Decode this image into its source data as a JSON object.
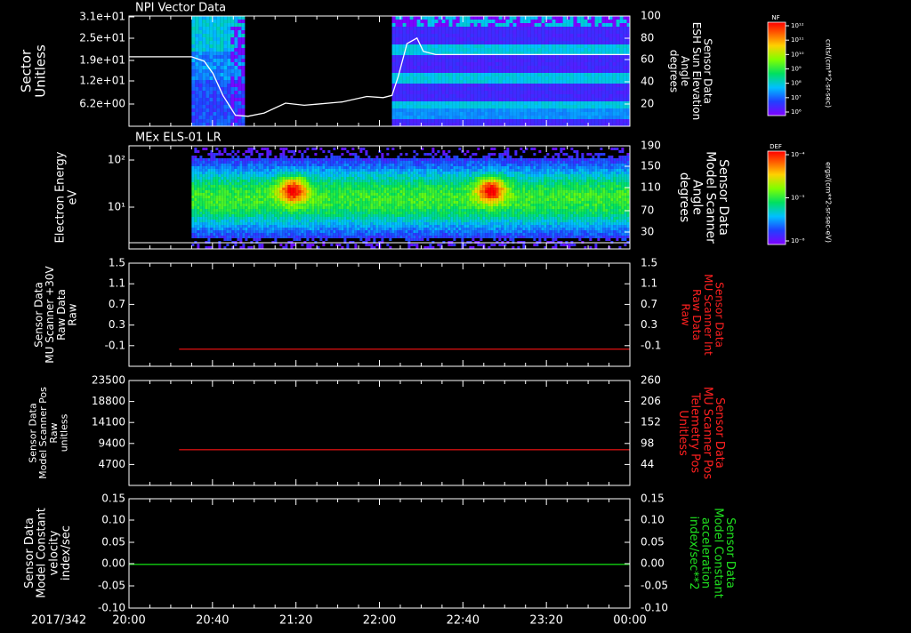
{
  "colors": {
    "background": "#000000",
    "axis": "#ffffff",
    "red_trace": "#d01010",
    "green_trace": "#10d010",
    "red_label": "#ff2020",
    "green_label": "#20e020"
  },
  "time_axis": {
    "date_label": "2017/342",
    "tick_labels": [
      "20:00",
      "20:40",
      "21:20",
      "22:00",
      "22:40",
      "23:20",
      "00:00"
    ]
  },
  "colorbars": [
    {
      "label": "NF",
      "units": "cnts/(cm**2-sr-sec)",
      "tick_labels": [
        "10¹²",
        "10¹¹",
        "10¹⁰",
        "10⁹",
        "10⁸",
        "10⁷",
        "10⁶"
      ]
    },
    {
      "label": "DEF",
      "units": "ergs/(cm**2-sr-sec-eV)",
      "tick_labels": [
        "10⁻⁴",
        "10⁻⁵",
        "10⁻⁶"
      ]
    }
  ],
  "chart_data": [
    {
      "type": "heatmap",
      "title": "NPI Vector Data",
      "ylabel": [
        "Sector",
        "Unitless"
      ],
      "yticks": [
        "3.1e+01",
        "2.5e+01",
        "1.9e+01",
        "1.2e+01",
        "6.2e+00"
      ],
      "right_ylabel": [
        "Sensor Data",
        "ESH Sun Elevation",
        "Angle",
        "degrees"
      ],
      "right_yticks": [
        "100",
        "80",
        "60",
        "40",
        "20"
      ],
      "right_ylim": [
        0,
        100
      ],
      "xlim_hours": [
        20,
        24
      ],
      "data_intervals_hours": [
        [
          20.5,
          20.9
        ],
        [
          22.1,
          24.0
        ]
      ],
      "overlay_line": {
        "color": "#ffffff",
        "x_hours": [
          20.0,
          20.33,
          20.5,
          20.6,
          20.67,
          20.75,
          20.85,
          20.95,
          21.08,
          21.25,
          21.4,
          21.5,
          21.7,
          21.9,
          22.03,
          22.1,
          22.15,
          22.22,
          22.3,
          22.35,
          22.45,
          22.6,
          22.8,
          23.0,
          23.5,
          24.0
        ],
        "y_values": [
          63,
          63,
          63,
          59,
          48,
          28,
          10,
          9,
          12,
          21,
          19,
          20,
          22,
          27,
          26,
          28,
          45,
          75,
          80,
          68,
          65,
          65,
          65,
          65,
          65,
          65
        ]
      }
    },
    {
      "type": "heatmap",
      "title": "MEx ELS-01 LR",
      "ylabel": [
        "Electron Energy",
        "eV"
      ],
      "yticks": [
        "10²",
        "10¹"
      ],
      "ylog": true,
      "right_ylabel": [
        "Sensor Data",
        "Model Scanner",
        "Angle",
        "degrees"
      ],
      "right_yticks": [
        "190",
        "150",
        "110",
        "70",
        "30"
      ],
      "right_ylim": [
        0,
        190
      ],
      "xlim_hours": [
        20,
        24
      ],
      "data_intervals_hours": [
        [
          20.5,
          24.0
        ]
      ],
      "hot_spots_hours": [
        21.3,
        22.88
      ],
      "overlay_line": {
        "color": "#ffffff",
        "x_hours": [
          20.0,
          24.0
        ],
        "y_values": [
          5,
          5
        ]
      }
    },
    {
      "type": "line",
      "ylabel": [
        "Sensor Data",
        "MU Scanner +30V",
        "Raw Data",
        "Raw"
      ],
      "yticks": [
        "1.5",
        "1.1",
        "0.7",
        "0.3",
        "-0.1"
      ],
      "ylim": [
        -0.3,
        1.5
      ],
      "right_ylabel": [
        "Sensor Data",
        "MU Scanner Int",
        "Raw Data",
        "Raw"
      ],
      "right_yticks": [
        "1.5",
        "1.1",
        "0.7",
        "0.3",
        "-0.1"
      ],
      "series": [
        {
          "color": "#d01010",
          "x_hours": [
            20.4,
            24.0
          ],
          "values": [
            0.0,
            0.0
          ]
        }
      ]
    },
    {
      "type": "line",
      "ylabel": [
        "Sensor Data",
        "Model Scanner Pos",
        "Raw",
        "unitless"
      ],
      "yticks": [
        "23500",
        "18800",
        "14100",
        "9400",
        "4700"
      ],
      "ylim": [
        0,
        23500
      ],
      "right_ylabel": [
        "Sensor Data",
        "MU Scanner Pos",
        "Telemetry Pos",
        "Unitless"
      ],
      "right_yticks": [
        "260",
        "206",
        "152",
        "98",
        "44"
      ],
      "right_ylim": [
        0,
        260
      ],
      "series": [
        {
          "color": "#d01010",
          "x_hours": [
            20.4,
            24.0
          ],
          "values": [
            8000,
            8000
          ]
        }
      ]
    },
    {
      "type": "line",
      "ylabel": [
        "Sensor Data",
        "Model Constant",
        "velocity",
        "index/sec"
      ],
      "yticks": [
        "0.15",
        "0.10",
        "0.05",
        "0.00",
        "-0.05",
        "-0.10"
      ],
      "ylim": [
        -0.1,
        0.15
      ],
      "right_ylabel": [
        "Sensor Data",
        "Model Constant",
        "acceleration",
        "index/sec**2"
      ],
      "right_yticks": [
        "0.15",
        "0.10",
        "0.05",
        "0.00",
        "-0.05",
        "-0.10"
      ],
      "series": [
        {
          "color": "#10d010",
          "x_hours": [
            20.0,
            24.0
          ],
          "values": [
            0.0,
            0.0
          ]
        }
      ]
    }
  ]
}
